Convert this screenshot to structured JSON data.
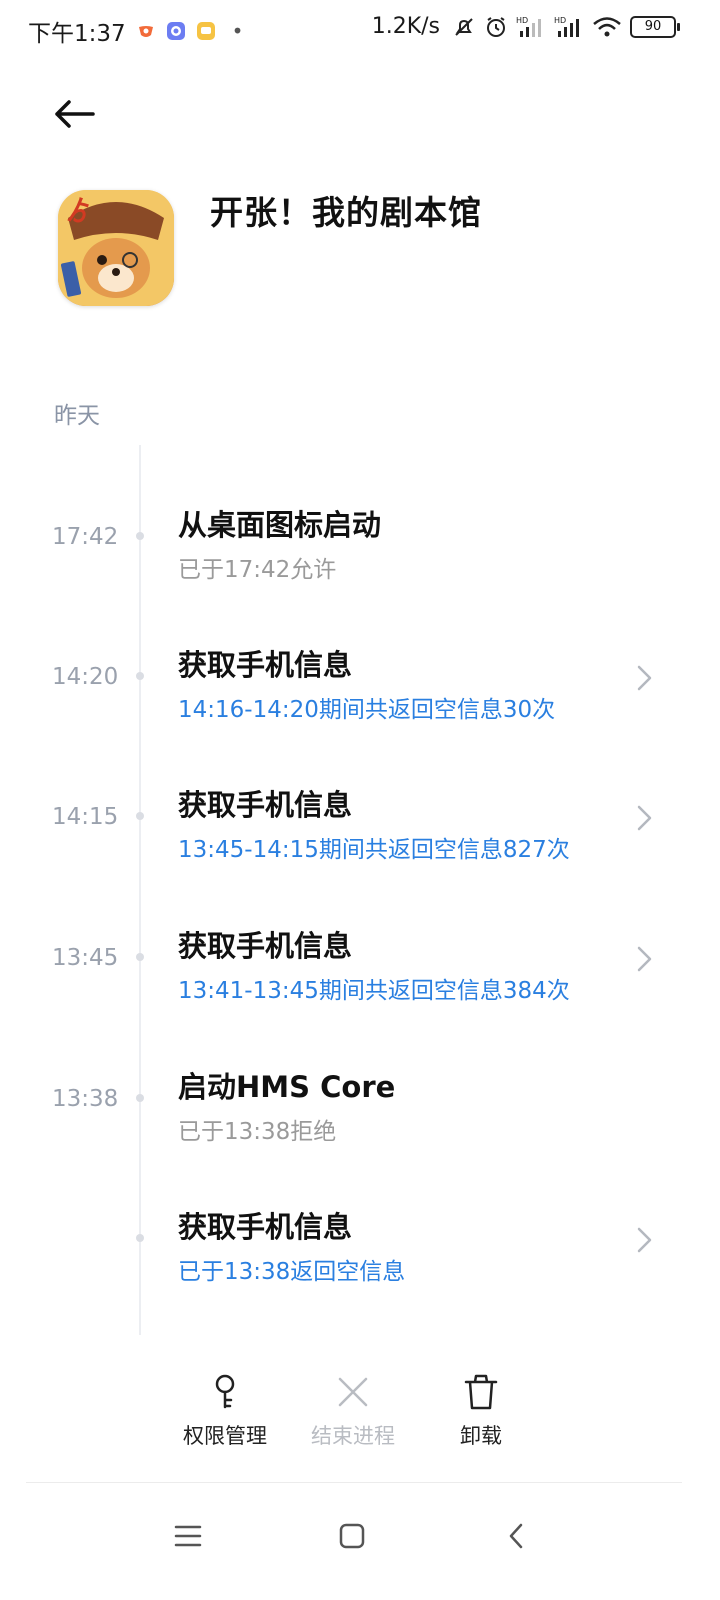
{
  "status_bar": {
    "time": "下午1:37",
    "speed": "1.2K/s",
    "battery": "90",
    "hd_label": "HD",
    "notification_icons": [
      "weibo-icon",
      "assistant-icon",
      "message-icon"
    ]
  },
  "header": {
    "app_name": "开张！我的剧本馆"
  },
  "section": {
    "date_label": "昨天"
  },
  "entries": [
    {
      "time": "17:42",
      "title": "从桌面图标启动",
      "subtitle": "已于17:42允许"
    },
    {
      "time": "14:20",
      "title": "获取手机信息",
      "subtitle": "14:16-14:20期间共返回空信息30次"
    },
    {
      "time": "14:15",
      "title": "获取手机信息",
      "subtitle": "13:45-14:15期间共返回空信息827次"
    },
    {
      "time": "13:45",
      "title": "获取手机信息",
      "subtitle": "13:41-13:45期间共返回空信息384次"
    },
    {
      "time": "13:38",
      "title": "启动HMS Core",
      "subtitle": "已于13:38拒绝"
    },
    {
      "time": "",
      "title": "获取手机信息",
      "subtitle": "已于13:38返回空信息"
    }
  ],
  "actions": {
    "permissions": "权限管理",
    "end_process": "结束进程",
    "uninstall": "卸载"
  },
  "colors": {
    "link": "#2a7fe0",
    "muted": "#9a9a9a",
    "timeline": "#eceef2"
  }
}
